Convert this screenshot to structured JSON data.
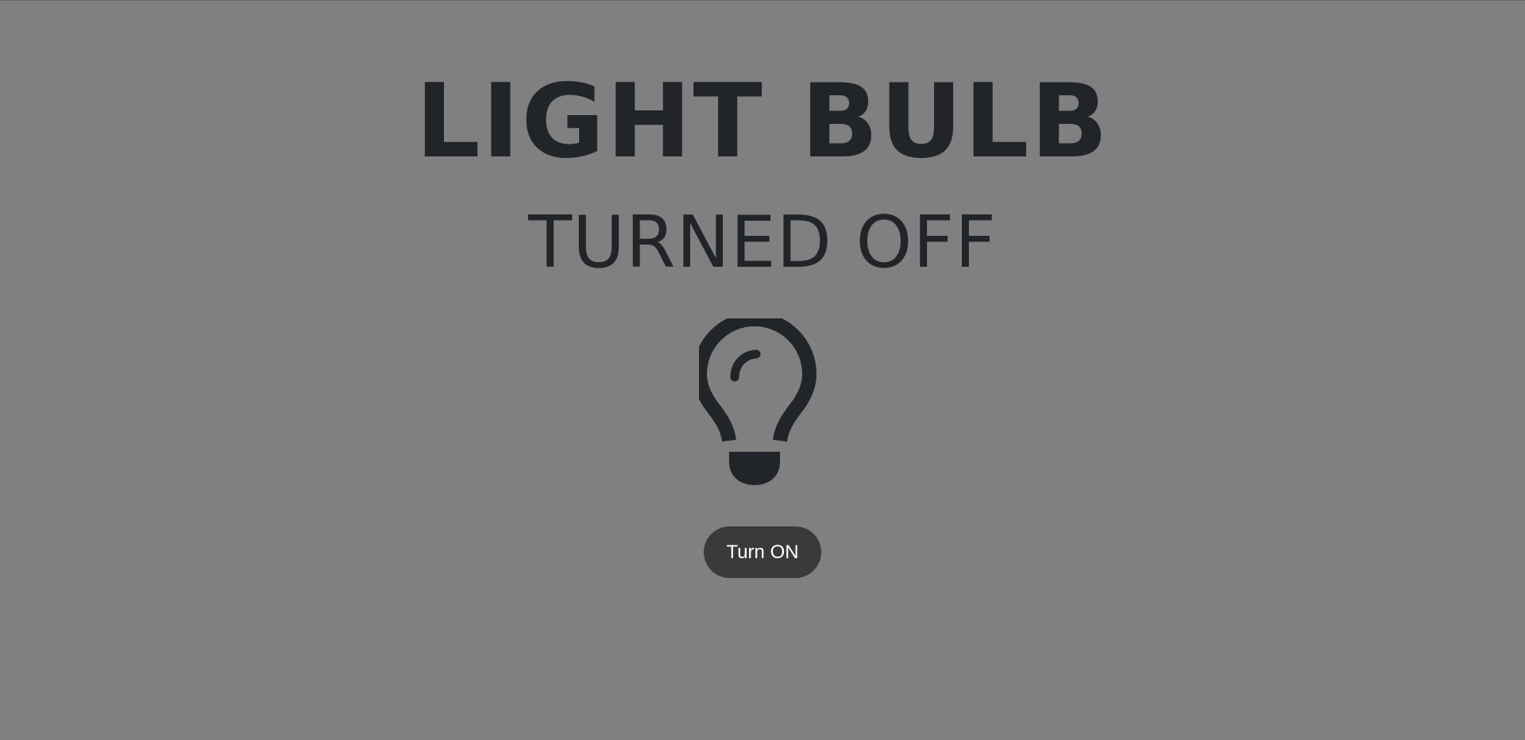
{
  "header": {
    "title": "LIGHT BULB",
    "status": "TURNED OFF"
  },
  "bulb": {
    "icon": "lightbulb-icon",
    "state": "off",
    "color": "#212529"
  },
  "controls": {
    "toggle_label": "Turn ON"
  },
  "theme": {
    "background": "#808080",
    "text": "#212529",
    "button_background": "#3a3a3a",
    "button_text": "#ffffff"
  }
}
